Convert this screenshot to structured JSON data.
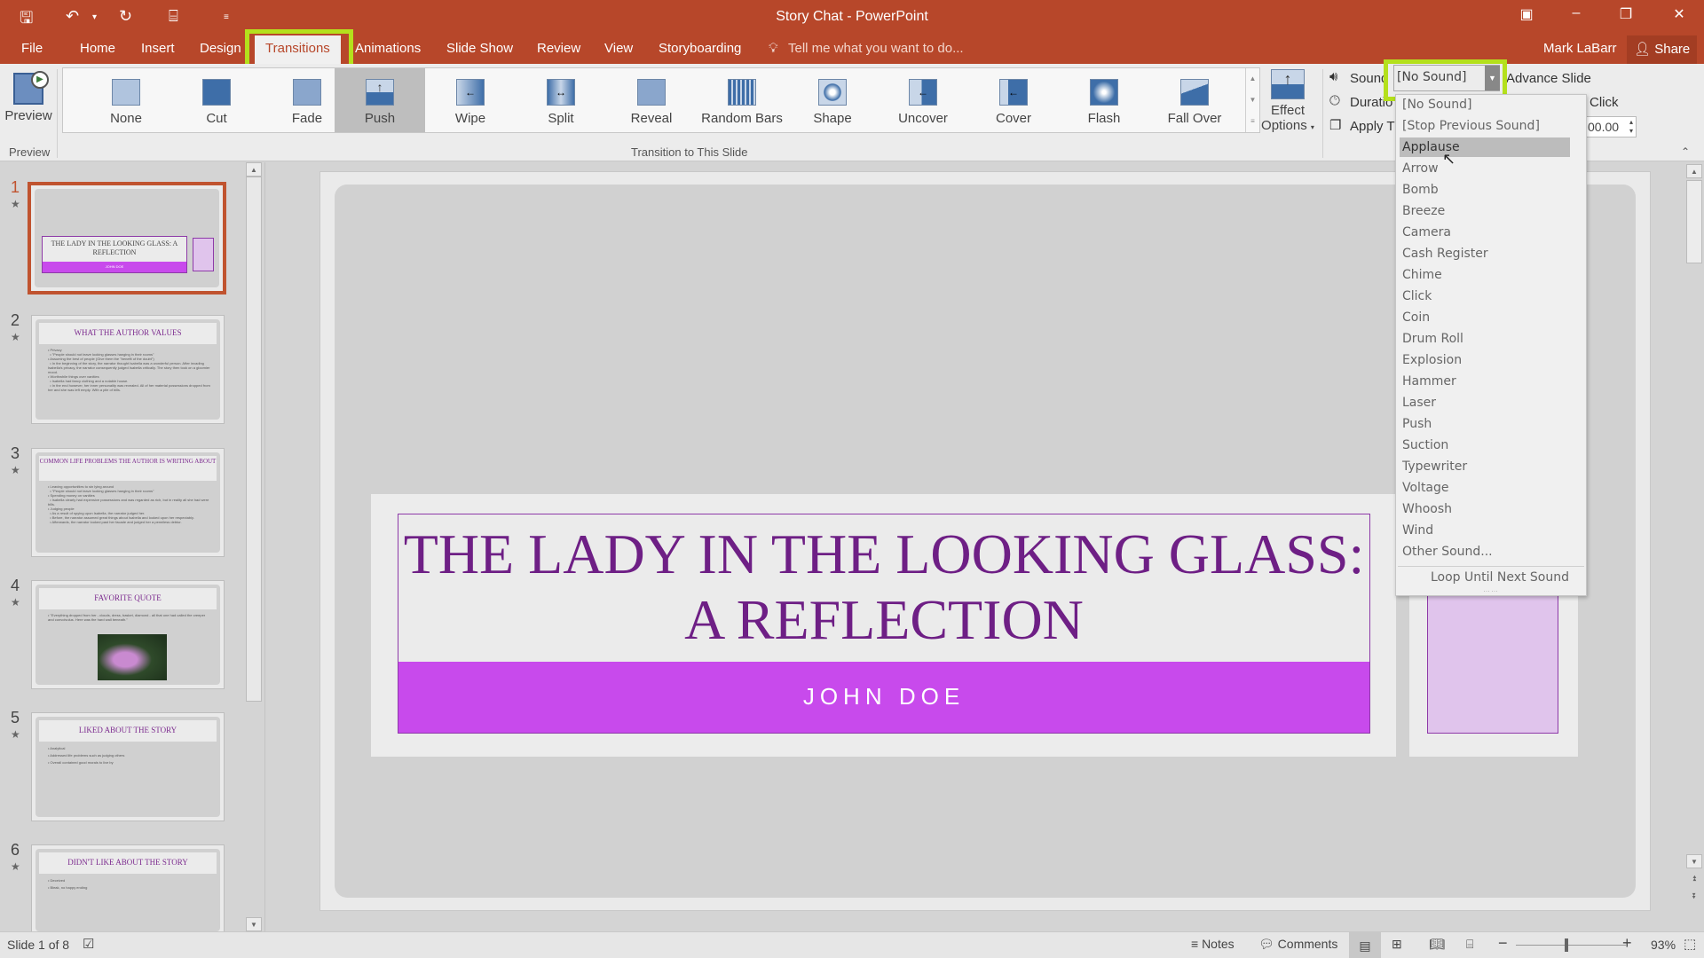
{
  "window": {
    "title": "Story Chat - PowerPoint",
    "user": "Mark LaBarr",
    "share_label": "Share"
  },
  "tabs": [
    {
      "label": "File"
    },
    {
      "label": "Home"
    },
    {
      "label": "Insert"
    },
    {
      "label": "Design"
    },
    {
      "label": "Transitions",
      "active": true
    },
    {
      "label": "Animations"
    },
    {
      "label": "Slide Show"
    },
    {
      "label": "Review"
    },
    {
      "label": "View"
    },
    {
      "label": "Storyboarding"
    }
  ],
  "tell_me": "Tell me what you want to do...",
  "ribbon": {
    "preview_label": "Preview",
    "preview_group": "Preview",
    "transition_group": "Transition to This Slide",
    "transitions": [
      {
        "label": "None"
      },
      {
        "label": "Cut"
      },
      {
        "label": "Fade"
      },
      {
        "label": "Push",
        "selected": true
      },
      {
        "label": "Wipe"
      },
      {
        "label": "Split"
      },
      {
        "label": "Reveal"
      },
      {
        "label": "Random Bars"
      },
      {
        "label": "Shape"
      },
      {
        "label": "Uncover"
      },
      {
        "label": "Cover"
      },
      {
        "label": "Flash"
      },
      {
        "label": "Fall Over"
      }
    ],
    "effect_options_line1": "Effect",
    "effect_options_line2": "Options",
    "sound_label": "Sound",
    "sound_value": "[No Sound]",
    "duration_label": "Duratio",
    "apply_label": "Apply T",
    "advance_slide": "Advance Slide",
    "on_click": "Click",
    "after_value": "00.00"
  },
  "sound_dropdown": {
    "items": [
      "[No Sound]",
      "[Stop Previous Sound]",
      "Applause",
      "Arrow",
      "Bomb",
      "Breeze",
      "Camera",
      "Cash Register",
      "Chime",
      "Click",
      "Coin",
      "Drum Roll",
      "Explosion",
      "Hammer",
      "Laser",
      "Push",
      "Suction",
      "Typewriter",
      "Voltage",
      "Whoosh",
      "Wind",
      "Other Sound..."
    ],
    "hovered": "Applause",
    "loop_label": "Loop Until Next Sound"
  },
  "thumbnails": [
    {
      "num": "1",
      "title": "THE LADY IN THE LOOKING GLASS: A REFLECTION",
      "subtitle": "JOHN DOE",
      "selected": true
    },
    {
      "num": "2",
      "title": "WHAT THE AUTHOR VALUES",
      "body": "• Privacy\n  • \"People should not leave looking glasses hanging in their rooms\"\n• Assuming the best of people (Give them the \"benefit of the doubt\")\n  • In the beginning of the story, the narrator thought Isabella was a wonderful person. After invading Isabella's privacy, the narrator consequently judged Isabella critically. The story then took on a gloomier mood.\n• Worthwhile things over vanities\n  • Isabella had fancy clothing and a notable house.\n  • In the end however, her inner personality was revealed. All of her material possessions dropped from her and she was left empty. With a pile of bills."
    },
    {
      "num": "3",
      "title": "COMMON LIFE PROBLEMS THE AUTHOR IS WRITING ABOUT",
      "body": "• Leaving opportunities to sin lying around\n  • \"People should not leave looking glasses hanging in their rooms\"\n• Spending money on vanities\n  • Isabella clearly had expensive possessions and was regarded as rich, but in reality all she had were bills.\n• Judging people\n  • As a result of spying upon Isabella, the narrator judged her.\n  • Before, the narrator assumed great things about Isabella and looked upon her respectably.\n  • Afterwards, the narrator looked past her facade and judged her a penniless debtor."
    },
    {
      "num": "4",
      "title": "FAVORITE QUOTE",
      "body": "• \"Everything dropped from her - clouds, dress, basket, diamond - all that one had called the creeper and convolvulus. Here was the hard wall beneath.\""
    },
    {
      "num": "5",
      "title": "LIKED ABOUT THE STORY",
      "body": "• Analytical\n• Addressed life problems such as judging others\n• Overall contained good morals to live by"
    },
    {
      "num": "6",
      "title": "DIDN'T LIKE ABOUT THE STORY",
      "body": "• Deceived\n• Bleak, no happy ending"
    }
  ],
  "slide": {
    "title": "THE LADY IN THE LOOKING GLASS: A REFLECTION",
    "subtitle": "JOHN DOE"
  },
  "status": {
    "slide_indicator": "Slide 1 of 8",
    "notes_label": "Notes",
    "comments_label": "Comments",
    "zoom_percent": "93%",
    "zoom_level": 0.93
  },
  "colors": {
    "accent": "#b7472a",
    "highlight": "#b4e01c",
    "title_purple": "#6e1f85",
    "subtitle_bar": "#c84aec"
  }
}
